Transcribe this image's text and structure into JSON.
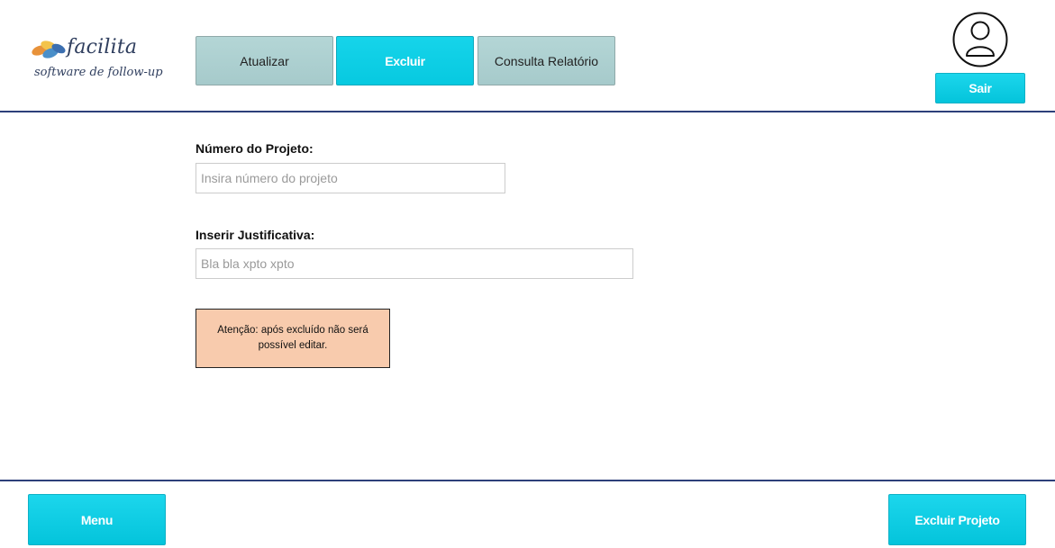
{
  "logo": {
    "name": "facilita",
    "tagline": "software de follow-up"
  },
  "tabs": [
    {
      "label": "Atualizar",
      "active": false
    },
    {
      "label": "Excluir",
      "active": true
    },
    {
      "label": "Consulta Relatório",
      "active": false
    }
  ],
  "user": {
    "icon": "user-avatar-icon",
    "logout_label": "Sair"
  },
  "form": {
    "project_number": {
      "label": "Número do Projeto:",
      "placeholder": "Insira número do projeto",
      "value": ""
    },
    "justification": {
      "label": "Inserir Justificativa:",
      "placeholder": "Bla bla xpto xpto",
      "value": ""
    }
  },
  "warning": {
    "text": "Atenção: após excluído não será possível editar."
  },
  "footer": {
    "menu_label": "Menu",
    "delete_project_label": "Excluir Projeto"
  },
  "colors": {
    "accent": "#07c9e0",
    "tab_inactive": "#a9cdce",
    "rule": "#2d3f7a",
    "warning_bg": "#f8cbad"
  }
}
